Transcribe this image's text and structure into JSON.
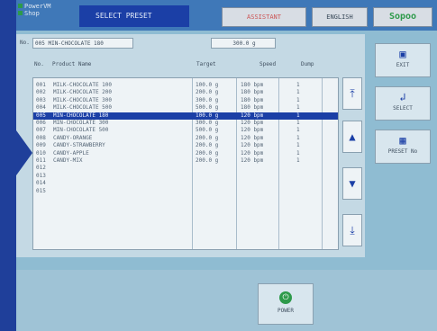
{
  "logo": {
    "line1": "PowerVM",
    "line2": "Shop"
  },
  "header": {
    "title": "SELECT PRESET",
    "assistant": "ASSISTANT",
    "language": "ENGLISH",
    "brand": "Sopoo"
  },
  "selected": {
    "label": "No.",
    "number": "005",
    "name": "MIN-CHOCOLATE 180",
    "target": "300.0 g"
  },
  "columns": {
    "no": "No.",
    "name": "Product Name",
    "target": "Target",
    "speed": "Speed",
    "dump": "Dump"
  },
  "rows": [
    {
      "no": "001",
      "name": "MILK-CHOCOLATE 100",
      "target": "100.0 g",
      "speed": "180 bpm",
      "dump": "1"
    },
    {
      "no": "002",
      "name": "MILK-CHOCOLATE 200",
      "target": "200.0 g",
      "speed": "180 bpm",
      "dump": "1"
    },
    {
      "no": "003",
      "name": "MILK-CHOCOLATE 300",
      "target": "300.0 g",
      "speed": "180 bpm",
      "dump": "1"
    },
    {
      "no": "004",
      "name": "MILK-CHOCOLATE 500",
      "target": "500.0 g",
      "speed": "180 bpm",
      "dump": "1"
    },
    {
      "no": "005",
      "name": "MIN-CHOCOLATE 180",
      "target": "100.0 g",
      "speed": "120 bpm",
      "dump": "1"
    },
    {
      "no": "006",
      "name": "MIN-CHOCOLATE 300",
      "target": "300.0 g",
      "speed": "120 bpm",
      "dump": "1"
    },
    {
      "no": "007",
      "name": "MIN-CHOCOLATE 500",
      "target": "500.0 g",
      "speed": "120 bpm",
      "dump": "1"
    },
    {
      "no": "008",
      "name": "CANDY-ORANGE",
      "target": "200.0 g",
      "speed": "120 bpm",
      "dump": "1"
    },
    {
      "no": "009",
      "name": "CANDY-STRAWBERRY",
      "target": "200.0 g",
      "speed": "120 bpm",
      "dump": "1"
    },
    {
      "no": "010",
      "name": "CANDY-APPLE",
      "target": "200.0 g",
      "speed": "120 bpm",
      "dump": "1"
    },
    {
      "no": "011",
      "name": "CANDY-MIX",
      "target": "200.0 g",
      "speed": "120 bpm",
      "dump": "1"
    },
    {
      "no": "012",
      "name": "",
      "target": "",
      "speed": "",
      "dump": ""
    },
    {
      "no": "013",
      "name": "",
      "target": "",
      "speed": "",
      "dump": ""
    },
    {
      "no": "014",
      "name": "",
      "target": "",
      "speed": "",
      "dump": ""
    },
    {
      "no": "015",
      "name": "",
      "target": "",
      "speed": "",
      "dump": ""
    }
  ],
  "selected_row_index": 4,
  "side": {
    "exit": "EXIT",
    "select": "SELECT",
    "preset": "PRESET No"
  },
  "bottom": {
    "power": "POWER"
  }
}
